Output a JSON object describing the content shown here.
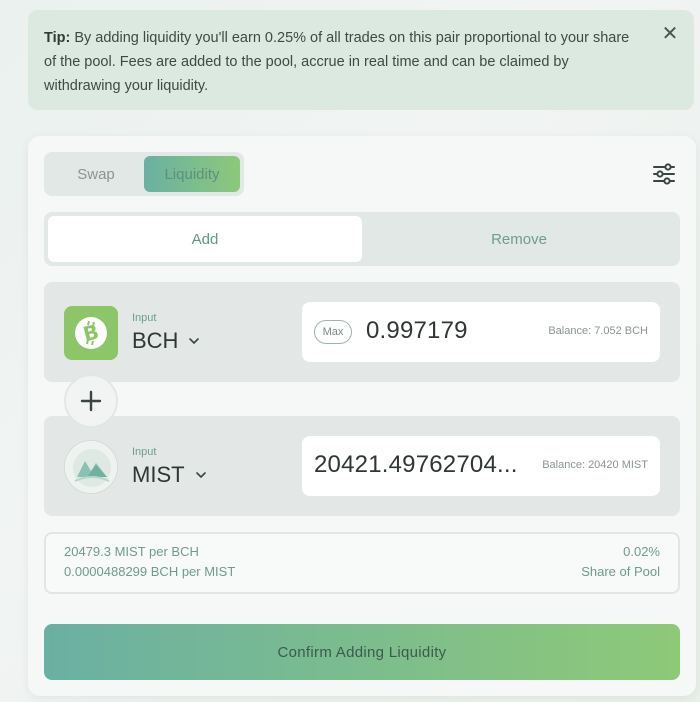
{
  "tip": {
    "label": "Tip:",
    "text": " By adding liquidity you'll earn 0.25% of all trades on this pair proportional to your share of the pool. Fees are added to the pool, accrue in real time and can be claimed by withdrawing your liquidity.",
    "close": "✕"
  },
  "mode": {
    "swap": "Swap",
    "liquidity": "Liquidity"
  },
  "tabs": {
    "add": "Add",
    "remove": "Remove"
  },
  "input1": {
    "caption": "Input",
    "token": "BCH",
    "max_label": "Max",
    "amount": "0.997179",
    "balance": "Balance: 7.052 BCH"
  },
  "input2": {
    "caption": "Input",
    "token": "MIST",
    "amount": "20421.49762704...",
    "balance": "Balance: 20420 MIST"
  },
  "rates": {
    "mist_per_bch": "20479.3 MIST per BCH",
    "bch_per_mist": "0.0000488299 BCH per MIST",
    "share_value": "0.02%",
    "share_label": "Share of Pool"
  },
  "confirm_label": "Confirm Adding Liquidity",
  "colors": {
    "accent_start": "#6ab0a3",
    "accent_end": "#8ec978",
    "bch_green": "#8cc668"
  },
  "icons": {
    "close": "close-icon",
    "settings": "settings-sliders-icon",
    "bch": "bitcoin-cash-icon",
    "mist": "mist-token-icon",
    "plus": "plus-icon",
    "chevron": "chevron-down-icon"
  }
}
